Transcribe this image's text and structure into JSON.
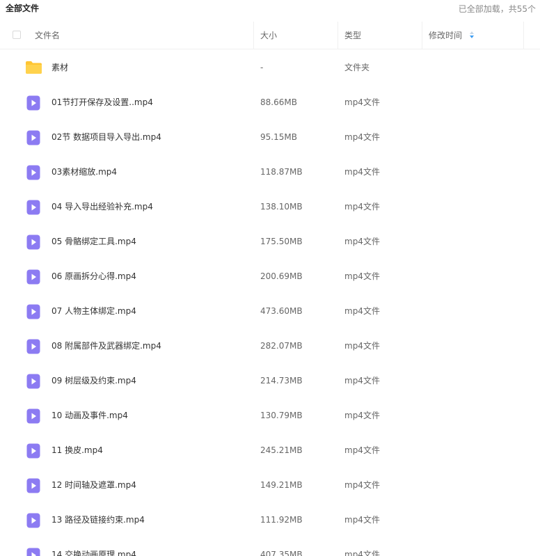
{
  "header": {
    "breadcrumb": "全部文件",
    "load_status": "已全部加载，共55个"
  },
  "columns": {
    "name": "文件名",
    "size": "大小",
    "type": "类型",
    "modified": "修改时间"
  },
  "colors": {
    "folder": "#FFC533",
    "video_icon": "#8C7BF2",
    "sort_active": "#3B9CF3"
  },
  "files": [
    {
      "icon": "folder-icon",
      "name": "素材",
      "size": "-",
      "type": "文件夹"
    },
    {
      "icon": "video-file-icon",
      "name": "01节打开保存及设置..mp4",
      "size": "88.66MB",
      "type": "mp4文件"
    },
    {
      "icon": "video-file-icon",
      "name": "02节 数据项目导入导出.mp4",
      "size": "95.15MB",
      "type": "mp4文件"
    },
    {
      "icon": "video-file-icon",
      "name": "03素材缩放.mp4",
      "size": "118.87MB",
      "type": "mp4文件"
    },
    {
      "icon": "video-file-icon",
      "name": "04 导入导出经验补充.mp4",
      "size": "138.10MB",
      "type": "mp4文件"
    },
    {
      "icon": "video-file-icon",
      "name": "05 骨骼绑定工具.mp4",
      "size": "175.50MB",
      "type": "mp4文件"
    },
    {
      "icon": "video-file-icon",
      "name": "06 原画拆分心得.mp4",
      "size": "200.69MB",
      "type": "mp4文件"
    },
    {
      "icon": "video-file-icon",
      "name": "07 人物主体绑定.mp4",
      "size": "473.60MB",
      "type": "mp4文件"
    },
    {
      "icon": "video-file-icon",
      "name": "08 附属部件及武器绑定.mp4",
      "size": "282.07MB",
      "type": "mp4文件"
    },
    {
      "icon": "video-file-icon",
      "name": "09 树层级及约束.mp4",
      "size": "214.73MB",
      "type": "mp4文件"
    },
    {
      "icon": "video-file-icon",
      "name": "10 动画及事件.mp4",
      "size": "130.79MB",
      "type": "mp4文件"
    },
    {
      "icon": "video-file-icon",
      "name": "11 换皮.mp4",
      "size": "245.21MB",
      "type": "mp4文件"
    },
    {
      "icon": "video-file-icon",
      "name": "12 时间轴及遮罩.mp4",
      "size": "149.21MB",
      "type": "mp4文件"
    },
    {
      "icon": "video-file-icon",
      "name": "13 路径及链接约束.mp4",
      "size": "111.92MB",
      "type": "mp4文件"
    },
    {
      "icon": "video-file-icon",
      "name": "14 交换动画原理.mp4",
      "size": "407.35MB",
      "type": "mp4文件"
    }
  ]
}
